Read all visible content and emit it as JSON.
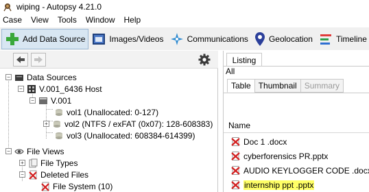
{
  "window": {
    "title": "wiping - Autopsy 4.21.0"
  },
  "menubar": [
    "Case",
    "View",
    "Tools",
    "Window",
    "Help"
  ],
  "toolbar": {
    "add_data_source": "Add Data Source",
    "images_videos": "Images/Videos",
    "communications": "Communications",
    "geolocation": "Geolocation",
    "timeline": "Timeline"
  },
  "tree": {
    "data_sources": "Data Sources",
    "host": "V.001_6436 Host",
    "image": "V.001",
    "vol1": "vol1 (Unallocated: 0-127)",
    "vol2": "vol2 (NTFS / exFAT (0x07): 128-608383)",
    "vol3": "vol3 (Unallocated: 608384-614399)",
    "file_views": "File Views",
    "file_types": "File Types",
    "deleted_files": "Deleted Files",
    "file_system": "File System (10)"
  },
  "listing": {
    "tab": "Listing",
    "scope": "All",
    "subtabs": [
      "Table",
      "Thumbnail",
      "Summary"
    ],
    "column_name": "Name",
    "files": [
      "Doc 1 .docx",
      "cyberforensics PR.pptx",
      "AUDIO KEYLOGGER CODE .docx",
      "internship ppt .pptx"
    ]
  },
  "colors": {
    "deleted_x": "#d21f1f",
    "highlight": "#ffff66",
    "selected_toolbar": "#d8e6f2"
  }
}
